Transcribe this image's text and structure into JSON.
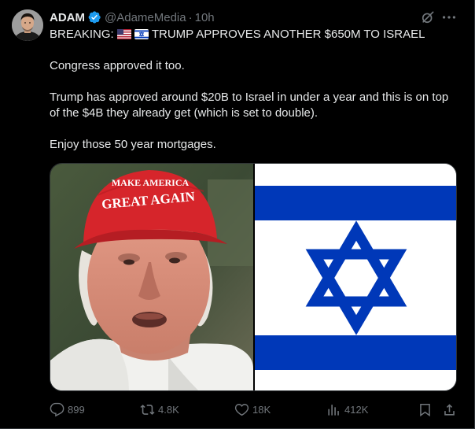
{
  "author": {
    "display_name": "ADAM",
    "handle": "@AdameMedia",
    "separator": "·",
    "time": "10h",
    "verified": true
  },
  "tweet": {
    "headline_prefix": "BREAKING:",
    "headline_rest": "TRUMP APPROVES ANOTHER $650M TO ISRAEL",
    "flags": [
      "us-flag-icon",
      "israel-flag-icon"
    ],
    "paragraph_2": "Congress approved it too.",
    "paragraph_3": "Trump has approved around $20B to Israel in under a year and this is on top of the $4B they already get (which is set to double).",
    "paragraph_4": "Enjoy those 50 year mortgages."
  },
  "media": {
    "left_image": "photo of man in red cap",
    "hat_text": "GREAT AGAIN",
    "hat_text_top": "MAKE AMERICA",
    "right_image": "israel-flag"
  },
  "actions": {
    "replies": "899",
    "reposts": "4.8K",
    "likes": "18K",
    "views": "412K"
  },
  "colors": {
    "background": "#000000",
    "text": "#e7e9ea",
    "muted": "#71767b",
    "verified": "#1d9bf0",
    "flag_blue": "#0038b8",
    "hat_red": "#d6252b"
  }
}
